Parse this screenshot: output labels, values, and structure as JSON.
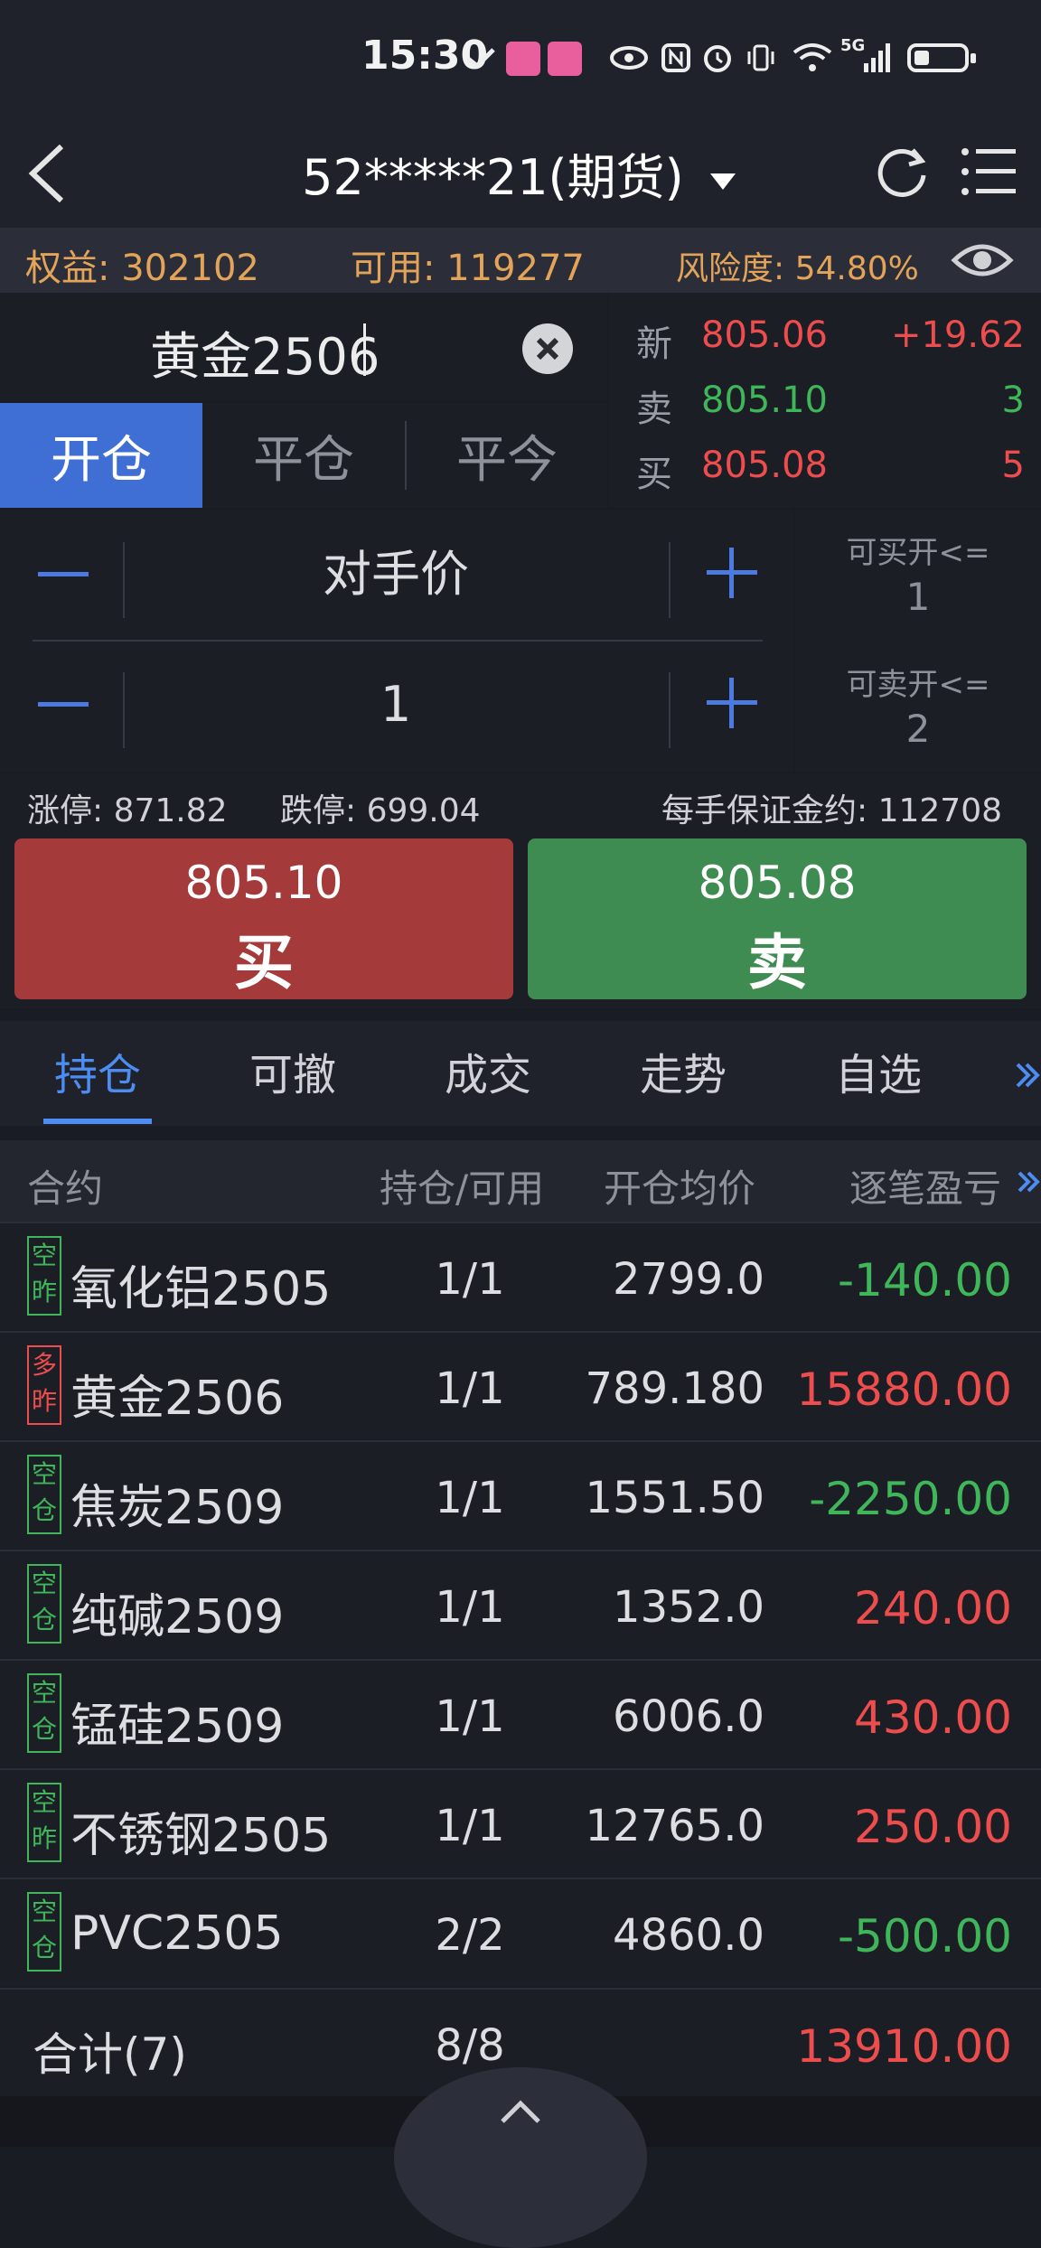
{
  "status_bar": {
    "time": "15:30",
    "network": "5G"
  },
  "nav": {
    "title": "52*****21(期货)"
  },
  "summary": {
    "equity": "权益: 302102",
    "available": "可用: 119277",
    "risk": "风险度: 54.80%"
  },
  "contract": {
    "name": "黄金2506"
  },
  "order_tabs": [
    "开仓",
    "平仓",
    "平今"
  ],
  "quote": {
    "latest": {
      "label": "新",
      "price": "805.06",
      "change": "+19.62"
    },
    "ask": {
      "label": "卖",
      "price": "805.10",
      "volume": "3"
    },
    "bid": {
      "label": "买",
      "price": "805.08",
      "volume": "5"
    }
  },
  "entry": {
    "price_mode": "对手价",
    "quantity": "1"
  },
  "limits": {
    "buy_open_label": "可买开<=",
    "buy_open_value": "1",
    "sell_open_label": "可卖开<=",
    "sell_open_value": "2"
  },
  "price_limits": {
    "up_limit": "涨停: 871.82",
    "down_limit": "跌停: 699.04",
    "margin": "每手保证金约: 112708"
  },
  "buttons": {
    "buy": {
      "price": "805.10",
      "action": "买"
    },
    "sell": {
      "price": "805.08",
      "action": "卖"
    }
  },
  "tabs": [
    "持仓",
    "可撤",
    "成交",
    "走势",
    "自选"
  ],
  "table": {
    "headers": [
      "合约",
      "持仓/可用",
      "开仓均价",
      "逐笔盈亏"
    ],
    "rows": [
      {
        "tag1": "空",
        "tag2": "昨",
        "tag_color": "green",
        "name": "氧化铝2505",
        "position": "1/1",
        "avg_price": "2799.0",
        "pnl": "-140.00",
        "pnl_color": "green"
      },
      {
        "tag1": "多",
        "tag2": "昨",
        "tag_color": "red",
        "name": "黄金2506",
        "position": "1/1",
        "avg_price": "789.180",
        "pnl": "15880.00",
        "pnl_color": "red"
      },
      {
        "tag1": "空",
        "tag2": "仓",
        "tag_color": "green",
        "name": "焦炭2509",
        "position": "1/1",
        "avg_price": "1551.50",
        "pnl": "-2250.00",
        "pnl_color": "green"
      },
      {
        "tag1": "空",
        "tag2": "仓",
        "tag_color": "green",
        "name": "纯碱2509",
        "position": "1/1",
        "avg_price": "1352.0",
        "pnl": "240.00",
        "pnl_color": "red"
      },
      {
        "tag1": "空",
        "tag2": "仓",
        "tag_color": "green",
        "name": "锰硅2509",
        "position": "1/1",
        "avg_price": "6006.0",
        "pnl": "430.00",
        "pnl_color": "red"
      },
      {
        "tag1": "空",
        "tag2": "昨",
        "tag_color": "green",
        "name": "不锈钢2505",
        "position": "1/1",
        "avg_price": "12765.0",
        "pnl": "250.00",
        "pnl_color": "red"
      },
      {
        "tag1": "空",
        "tag2": "仓",
        "tag_color": "green",
        "name": "PVC2505",
        "position": "2/2",
        "avg_price": "4860.0",
        "pnl": "-500.00",
        "pnl_color": "green"
      }
    ],
    "total": {
      "label": "合计(7)",
      "position": "8/8",
      "pnl": "13910.00"
    }
  },
  "colors": {
    "accent": "#3f6ed4",
    "buy": "#a43a3a",
    "sell": "#3f8c52",
    "up": "#ee4d4d",
    "down": "#3fb65a",
    "warn": "#e3a45a"
  }
}
